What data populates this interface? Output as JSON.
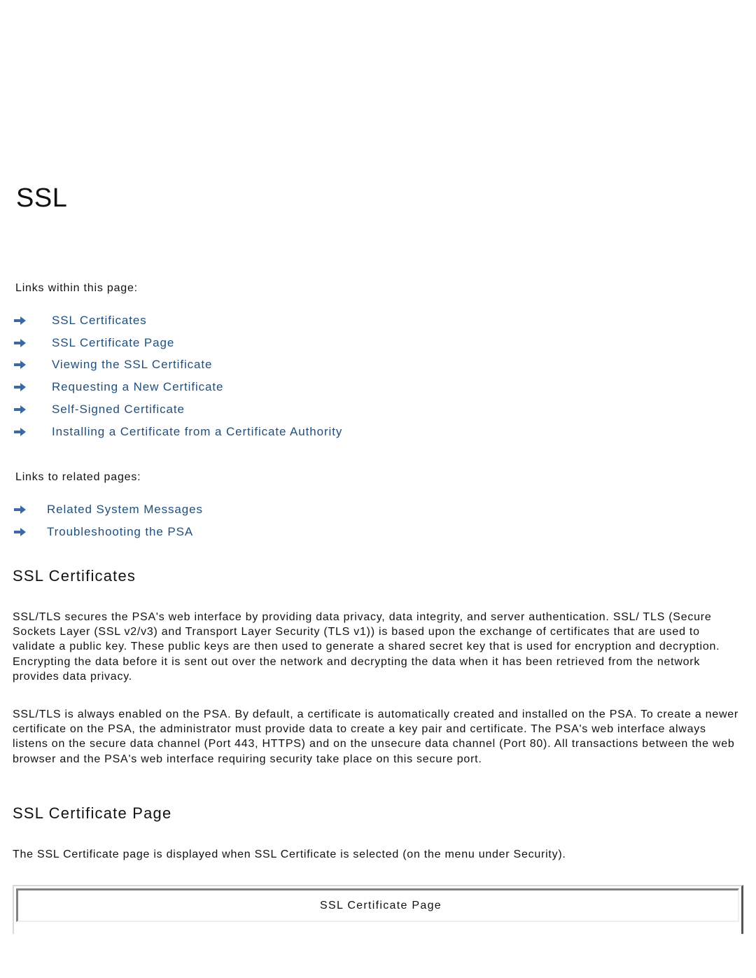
{
  "page": {
    "title": "SSL"
  },
  "links_within": {
    "label": "Links within this page:",
    "items": [
      {
        "label": "SSL Certificates",
        "icon": "arrow-right-icon"
      },
      {
        "label": "SSL Certificate Page",
        "icon": "arrow-right-icon"
      },
      {
        "label": "Viewing the SSL Certificate",
        "icon": "arrow-right-icon"
      },
      {
        "label": "Requesting a New Certificate",
        "icon": "arrow-right-icon"
      },
      {
        "label": "Self-Signed Certificate",
        "icon": "arrow-right-icon"
      },
      {
        "label": "Installing a Certificate from a Certificate Authority",
        "icon": "arrow-right-icon"
      }
    ]
  },
  "links_related": {
    "label": "Links to related pages:",
    "items": [
      {
        "label": "Related System Messages",
        "icon": "arrow-right-icon"
      },
      {
        "label": "Troubleshooting the PSA",
        "icon": "arrow-right-icon"
      }
    ]
  },
  "sections": {
    "ssl_certificates": {
      "heading": "SSL Certificates",
      "paragraphs": [
        "SSL/TLS secures the PSA's web interface by providing data privacy, data integrity, and server authentication. SSL/ TLS (Secure Sockets Layer (SSL v2/v3) and Transport Layer Security (TLS v1)) is based upon the exchange of certificates that are used to validate a public key. These public keys are then used to generate a shared secret key that is used for encryption and decryption. Encrypting the data before it is sent out over the network and decrypting the data when it has been retrieved from the network provides data privacy.",
        "SSL/TLS is always enabled on the PSA. By default, a certificate is automatically created and installed on the PSA. To create a newer certificate on the PSA, the administrator must provide data to create a key pair and certificate. The PSA's web interface always listens on the secure data channel (Port 443, HTTPS) and on the unsecure data channel (Port 80). All transactions between the web browser and the PSA's web interface requiring security take place on this secure port."
      ]
    },
    "ssl_certificate_page": {
      "heading": "SSL Certificate Page",
      "paragraphs": [
        "The SSL Certificate page is displayed when SSL Certificate is selected (on the menu under Security)."
      ],
      "figure_caption": "SSL Certificate Page"
    }
  },
  "colors": {
    "link": "#1f4f7e",
    "arrow": "#3a6aa6",
    "text": "#111111"
  }
}
